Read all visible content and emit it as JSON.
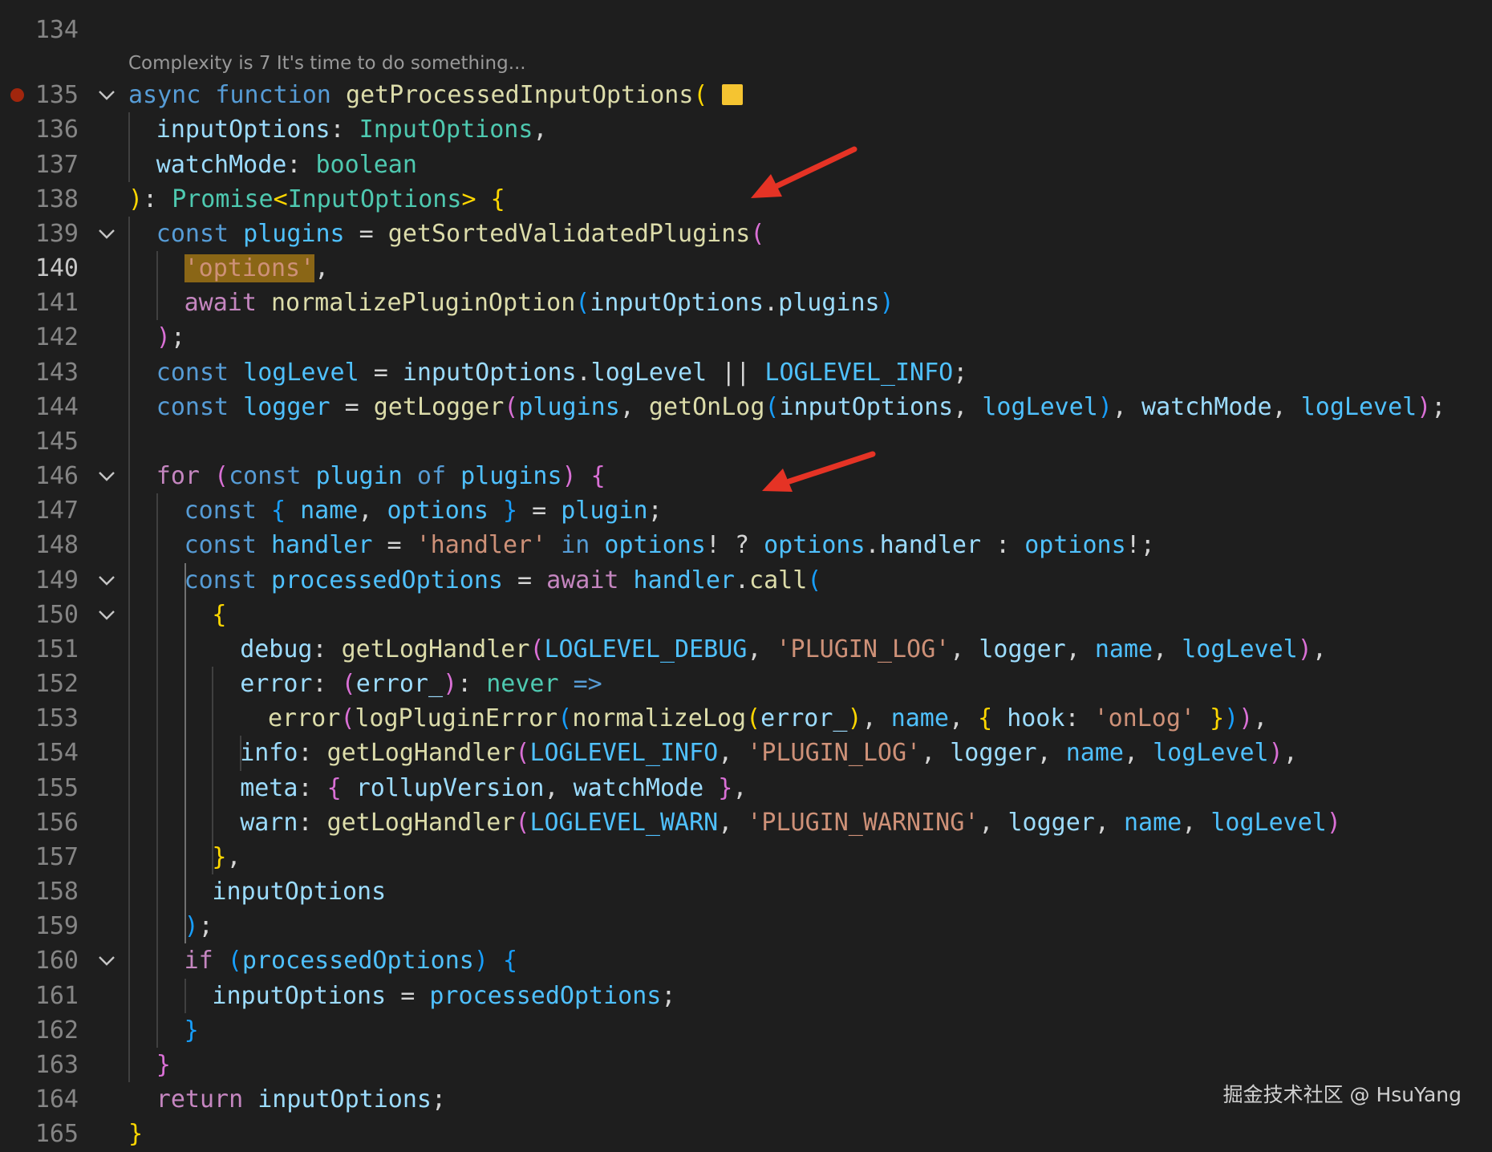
{
  "editor": {
    "codelens": "Complexity is 7 It's time to do something...",
    "breakpoint_line": 135,
    "active_line": 140,
    "colors": {
      "keyword": "#569cd6",
      "control": "#c586c0",
      "function": "#dcdcaa",
      "variable": "#9cdcfe",
      "type": "#4ec9b0",
      "string": "#ce9178",
      "constant": "#4fc1ff",
      "highlight": "#8a6616",
      "arrow": "#e53325"
    },
    "lines": [
      {
        "n": "134",
        "indent": 0,
        "fold": false,
        "tokens": []
      },
      {
        "n": "135",
        "indent": 0,
        "fold": true,
        "swatch": true,
        "tokens": [
          [
            "k",
            "async"
          ],
          [
            "p",
            " "
          ],
          [
            "k",
            "function"
          ],
          [
            "p",
            " "
          ],
          [
            "f",
            "getProcessedInputOptions"
          ],
          [
            "b1",
            "("
          ]
        ]
      },
      {
        "n": "136",
        "indent": 1,
        "fold": false,
        "tokens": [
          [
            "v",
            "inputOptions"
          ],
          [
            "p",
            ": "
          ],
          [
            "t",
            "InputOptions"
          ],
          [
            "p",
            ","
          ]
        ]
      },
      {
        "n": "137",
        "indent": 1,
        "fold": false,
        "tokens": [
          [
            "v",
            "watchMode"
          ],
          [
            "p",
            ": "
          ],
          [
            "t",
            "boolean"
          ]
        ]
      },
      {
        "n": "138",
        "indent": 0,
        "fold": false,
        "tokens": [
          [
            "b1",
            ")"
          ],
          [
            "p",
            ": "
          ],
          [
            "t",
            "Promise"
          ],
          [
            "b1",
            "<"
          ],
          [
            "t",
            "InputOptions"
          ],
          [
            "b1",
            ">"
          ],
          [
            "p",
            " "
          ],
          [
            "b1",
            "{"
          ]
        ]
      },
      {
        "n": "139",
        "indent": 1,
        "fold": true,
        "tokens": [
          [
            "k",
            "const"
          ],
          [
            "p",
            " "
          ],
          [
            "cn",
            "plugins"
          ],
          [
            "p",
            " = "
          ],
          [
            "f",
            "getSortedValidatedPlugins"
          ],
          [
            "b2",
            "("
          ]
        ]
      },
      {
        "n": "140",
        "indent": 2,
        "fold": false,
        "tokens": [
          [
            "s hl",
            "'options'"
          ],
          [
            "p",
            ","
          ]
        ]
      },
      {
        "n": "141",
        "indent": 2,
        "fold": false,
        "tokens": [
          [
            "c",
            "await"
          ],
          [
            "p",
            " "
          ],
          [
            "f",
            "normalizePluginOption"
          ],
          [
            "b3",
            "("
          ],
          [
            "v",
            "inputOptions"
          ],
          [
            "p",
            "."
          ],
          [
            "v",
            "plugins"
          ],
          [
            "b3",
            ")"
          ]
        ]
      },
      {
        "n": "142",
        "indent": 1,
        "fold": false,
        "tokens": [
          [
            "b2",
            ")"
          ],
          [
            "p",
            ";"
          ]
        ]
      },
      {
        "n": "143",
        "indent": 1,
        "fold": false,
        "tokens": [
          [
            "k",
            "const"
          ],
          [
            "p",
            " "
          ],
          [
            "cn",
            "logLevel"
          ],
          [
            "p",
            " = "
          ],
          [
            "v",
            "inputOptions"
          ],
          [
            "p",
            "."
          ],
          [
            "v",
            "logLevel"
          ],
          [
            "p",
            " || "
          ],
          [
            "cn",
            "LOGLEVEL_INFO"
          ],
          [
            "p",
            ";"
          ]
        ]
      },
      {
        "n": "144",
        "indent": 1,
        "fold": false,
        "tokens": [
          [
            "k",
            "const"
          ],
          [
            "p",
            " "
          ],
          [
            "cn",
            "logger"
          ],
          [
            "p",
            " = "
          ],
          [
            "f",
            "getLogger"
          ],
          [
            "b2",
            "("
          ],
          [
            "cn",
            "plugins"
          ],
          [
            "p",
            ", "
          ],
          [
            "f",
            "getOnLog"
          ],
          [
            "b3",
            "("
          ],
          [
            "v",
            "inputOptions"
          ],
          [
            "p",
            ", "
          ],
          [
            "cn",
            "logLevel"
          ],
          [
            "b3",
            ")"
          ],
          [
            "p",
            ", "
          ],
          [
            "v",
            "watchMode"
          ],
          [
            "p",
            ", "
          ],
          [
            "cn",
            "logLevel"
          ],
          [
            "b2",
            ")"
          ],
          [
            "p",
            ";"
          ]
        ]
      },
      {
        "n": "145",
        "indent": 0,
        "fold": false,
        "tokens": []
      },
      {
        "n": "146",
        "indent": 1,
        "fold": true,
        "tokens": [
          [
            "c",
            "for"
          ],
          [
            "p",
            " "
          ],
          [
            "b2",
            "("
          ],
          [
            "k",
            "const"
          ],
          [
            "p",
            " "
          ],
          [
            "cn",
            "plugin"
          ],
          [
            "p",
            " "
          ],
          [
            "k",
            "of"
          ],
          [
            "p",
            " "
          ],
          [
            "cn",
            "plugins"
          ],
          [
            "b2",
            ")"
          ],
          [
            "p",
            " "
          ],
          [
            "b2",
            "{"
          ]
        ]
      },
      {
        "n": "147",
        "indent": 2,
        "fold": false,
        "tokens": [
          [
            "k",
            "const"
          ],
          [
            "p",
            " "
          ],
          [
            "b3",
            "{"
          ],
          [
            "p",
            " "
          ],
          [
            "cn",
            "name"
          ],
          [
            "p",
            ", "
          ],
          [
            "cn",
            "options"
          ],
          [
            "p",
            " "
          ],
          [
            "b3",
            "}"
          ],
          [
            "p",
            " = "
          ],
          [
            "cn",
            "plugin"
          ],
          [
            "p",
            ";"
          ]
        ]
      },
      {
        "n": "148",
        "indent": 2,
        "fold": false,
        "tokens": [
          [
            "k",
            "const"
          ],
          [
            "p",
            " "
          ],
          [
            "cn",
            "handler"
          ],
          [
            "p",
            " = "
          ],
          [
            "s",
            "'handler'"
          ],
          [
            "p",
            " "
          ],
          [
            "k",
            "in"
          ],
          [
            "p",
            " "
          ],
          [
            "cn",
            "options"
          ],
          [
            "p",
            "! ? "
          ],
          [
            "cn",
            "options"
          ],
          [
            "p",
            "."
          ],
          [
            "v",
            "handler"
          ],
          [
            "p",
            " : "
          ],
          [
            "cn",
            "options"
          ],
          [
            "p",
            "!;"
          ]
        ]
      },
      {
        "n": "149",
        "indent": 2,
        "fold": true,
        "tokens": [
          [
            "k",
            "const"
          ],
          [
            "p",
            " "
          ],
          [
            "cn",
            "processedOptions"
          ],
          [
            "p",
            " = "
          ],
          [
            "c",
            "await"
          ],
          [
            "p",
            " "
          ],
          [
            "cn",
            "handler"
          ],
          [
            "p",
            "."
          ],
          [
            "f",
            "call"
          ],
          [
            "b3",
            "("
          ]
        ]
      },
      {
        "n": "150",
        "indent": 3,
        "fold": true,
        "tokens": [
          [
            "b1",
            "{"
          ]
        ]
      },
      {
        "n": "151",
        "indent": 4,
        "fold": false,
        "tokens": [
          [
            "v",
            "debug"
          ],
          [
            "p",
            ": "
          ],
          [
            "f",
            "getLogHandler"
          ],
          [
            "b2",
            "("
          ],
          [
            "cn",
            "LOGLEVEL_DEBUG"
          ],
          [
            "p",
            ", "
          ],
          [
            "s",
            "'PLUGIN_LOG'"
          ],
          [
            "p",
            ", "
          ],
          [
            "v",
            "logger"
          ],
          [
            "p",
            ", "
          ],
          [
            "cn",
            "name"
          ],
          [
            "p",
            ", "
          ],
          [
            "cn",
            "logLevel"
          ],
          [
            "b2",
            ")"
          ],
          [
            "p",
            ","
          ]
        ]
      },
      {
        "n": "152",
        "indent": 4,
        "fold": false,
        "tokens": [
          [
            "v",
            "error"
          ],
          [
            "p",
            ": "
          ],
          [
            "b2",
            "("
          ],
          [
            "v",
            "error_"
          ],
          [
            "b2",
            ")"
          ],
          [
            "p",
            ": "
          ],
          [
            "t",
            "never"
          ],
          [
            "p",
            " "
          ],
          [
            "k",
            "=>"
          ]
        ]
      },
      {
        "n": "153",
        "indent": 5,
        "fold": false,
        "tokens": [
          [
            "f",
            "error"
          ],
          [
            "b2",
            "("
          ],
          [
            "f",
            "logPluginError"
          ],
          [
            "b3",
            "("
          ],
          [
            "f",
            "normalizeLog"
          ],
          [
            "b1",
            "("
          ],
          [
            "v",
            "error_"
          ],
          [
            "b1",
            ")"
          ],
          [
            "p",
            ", "
          ],
          [
            "cn",
            "name"
          ],
          [
            "p",
            ", "
          ],
          [
            "b1",
            "{"
          ],
          [
            "p",
            " "
          ],
          [
            "v",
            "hook"
          ],
          [
            "p",
            ": "
          ],
          [
            "s",
            "'onLog'"
          ],
          [
            "p",
            " "
          ],
          [
            "b1",
            "}"
          ],
          [
            "b3",
            ")"
          ],
          [
            "b2",
            ")"
          ],
          [
            "p",
            ","
          ]
        ]
      },
      {
        "n": "154",
        "indent": 4,
        "fold": false,
        "tokens": [
          [
            "v",
            "info"
          ],
          [
            "p",
            ": "
          ],
          [
            "f",
            "getLogHandler"
          ],
          [
            "b2",
            "("
          ],
          [
            "cn",
            "LOGLEVEL_INFO"
          ],
          [
            "p",
            ", "
          ],
          [
            "s",
            "'PLUGIN_LOG'"
          ],
          [
            "p",
            ", "
          ],
          [
            "v",
            "logger"
          ],
          [
            "p",
            ", "
          ],
          [
            "cn",
            "name"
          ],
          [
            "p",
            ", "
          ],
          [
            "cn",
            "logLevel"
          ],
          [
            "b2",
            ")"
          ],
          [
            "p",
            ","
          ]
        ]
      },
      {
        "n": "155",
        "indent": 4,
        "fold": false,
        "tokens": [
          [
            "v",
            "meta"
          ],
          [
            "p",
            ": "
          ],
          [
            "b2",
            "{"
          ],
          [
            "p",
            " "
          ],
          [
            "v",
            "rollupVersion"
          ],
          [
            "p",
            ", "
          ],
          [
            "v",
            "watchMode"
          ],
          [
            "p",
            " "
          ],
          [
            "b2",
            "}"
          ],
          [
            "p",
            ","
          ]
        ]
      },
      {
        "n": "156",
        "indent": 4,
        "fold": false,
        "tokens": [
          [
            "v",
            "warn"
          ],
          [
            "p",
            ": "
          ],
          [
            "f",
            "getLogHandler"
          ],
          [
            "b2",
            "("
          ],
          [
            "cn",
            "LOGLEVEL_WARN"
          ],
          [
            "p",
            ", "
          ],
          [
            "s",
            "'PLUGIN_WARNING'"
          ],
          [
            "p",
            ", "
          ],
          [
            "v",
            "logger"
          ],
          [
            "p",
            ", "
          ],
          [
            "cn",
            "name"
          ],
          [
            "p",
            ", "
          ],
          [
            "cn",
            "logLevel"
          ],
          [
            "b2",
            ")"
          ]
        ]
      },
      {
        "n": "157",
        "indent": 3,
        "fold": false,
        "tokens": [
          [
            "b1",
            "}"
          ],
          [
            "p",
            ","
          ]
        ]
      },
      {
        "n": "158",
        "indent": 3,
        "fold": false,
        "tokens": [
          [
            "v",
            "inputOptions"
          ]
        ]
      },
      {
        "n": "159",
        "indent": 2,
        "fold": false,
        "tokens": [
          [
            "b3",
            ")"
          ],
          [
            "p",
            ";"
          ]
        ]
      },
      {
        "n": "160",
        "indent": 2,
        "fold": true,
        "tokens": [
          [
            "c",
            "if"
          ],
          [
            "p",
            " "
          ],
          [
            "b3",
            "("
          ],
          [
            "cn",
            "processedOptions"
          ],
          [
            "b3",
            ")"
          ],
          [
            "p",
            " "
          ],
          [
            "b3",
            "{"
          ]
        ]
      },
      {
        "n": "161",
        "indent": 3,
        "fold": false,
        "tokens": [
          [
            "v",
            "inputOptions"
          ],
          [
            "p",
            " = "
          ],
          [
            "cn",
            "processedOptions"
          ],
          [
            "p",
            ";"
          ]
        ]
      },
      {
        "n": "162",
        "indent": 2,
        "fold": false,
        "tokens": [
          [
            "b3",
            "}"
          ]
        ]
      },
      {
        "n": "163",
        "indent": 1,
        "fold": false,
        "tokens": [
          [
            "b2",
            "}"
          ]
        ]
      },
      {
        "n": "164",
        "indent": 1,
        "fold": false,
        "tokens": [
          [
            "c",
            "return"
          ],
          [
            "p",
            " "
          ],
          [
            "v",
            "inputOptions"
          ],
          [
            "p",
            ";"
          ]
        ]
      },
      {
        "n": "165",
        "indent": 0,
        "fold": false,
        "tokens": [
          [
            "b1",
            "}"
          ]
        ]
      }
    ]
  },
  "watermark": "掘金技术社区 @ HsuYang"
}
